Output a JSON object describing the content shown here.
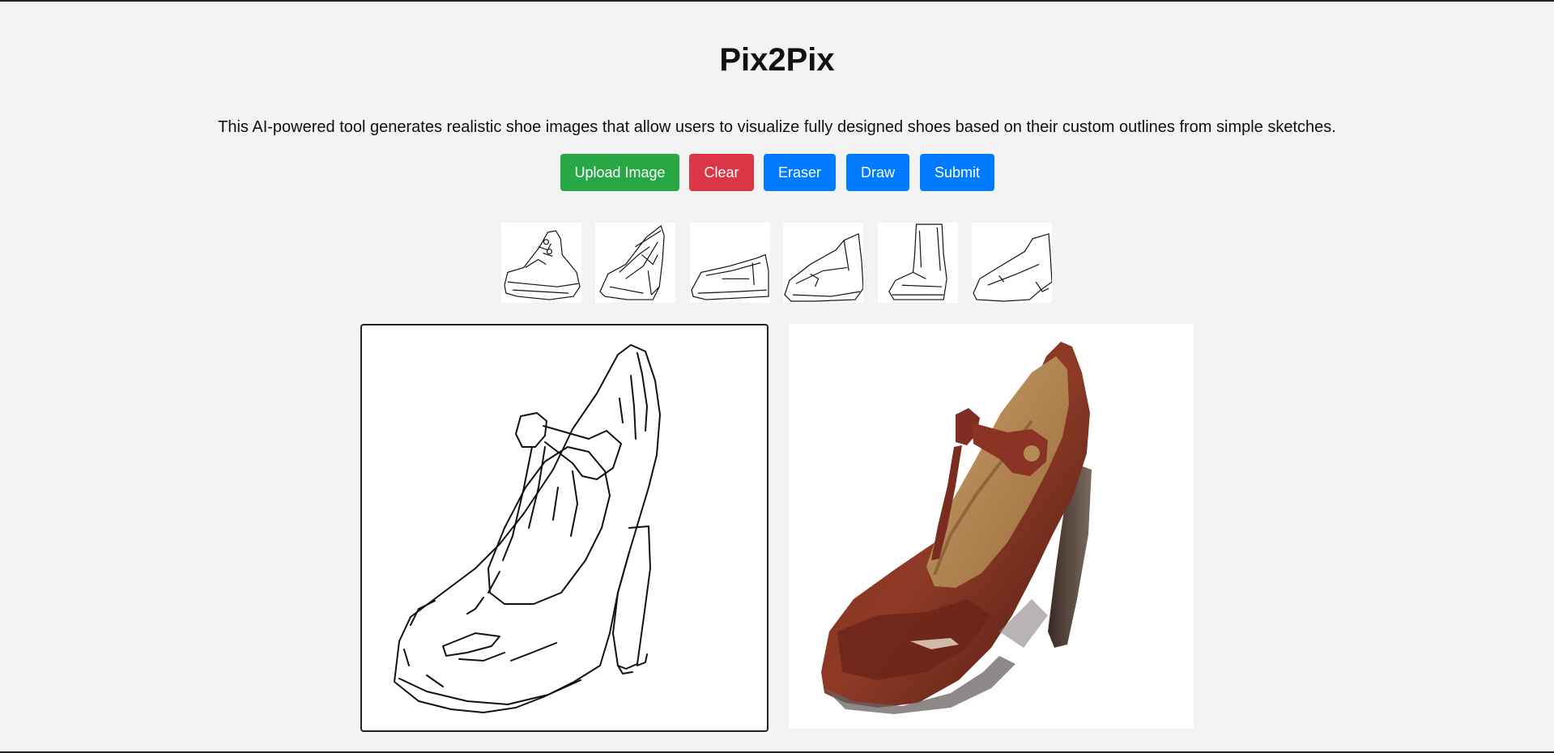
{
  "app": {
    "title": "Pix2Pix",
    "description": "This AI-powered tool generates realistic shoe images that allow users to visualize fully designed shoes based on their custom outlines from simple sketches."
  },
  "toolbar": {
    "upload_label": "Upload Image",
    "clear_label": "Clear",
    "eraser_label": "Eraser",
    "draw_label": "Draw",
    "submit_label": "Submit"
  },
  "colors": {
    "upload": "#28a745",
    "clear": "#dc3545",
    "action": "#007bff",
    "background": "#f3f3f3"
  },
  "sample_sketches": [
    {
      "icon": "sneaker-sketch-icon"
    },
    {
      "icon": "heel-sketch-icon"
    },
    {
      "icon": "loafer-sketch-icon"
    },
    {
      "icon": "ankle-boot-sketch-icon"
    },
    {
      "icon": "tall-boot-sketch-icon"
    },
    {
      "icon": "heeled-bootie-sketch-icon"
    }
  ]
}
